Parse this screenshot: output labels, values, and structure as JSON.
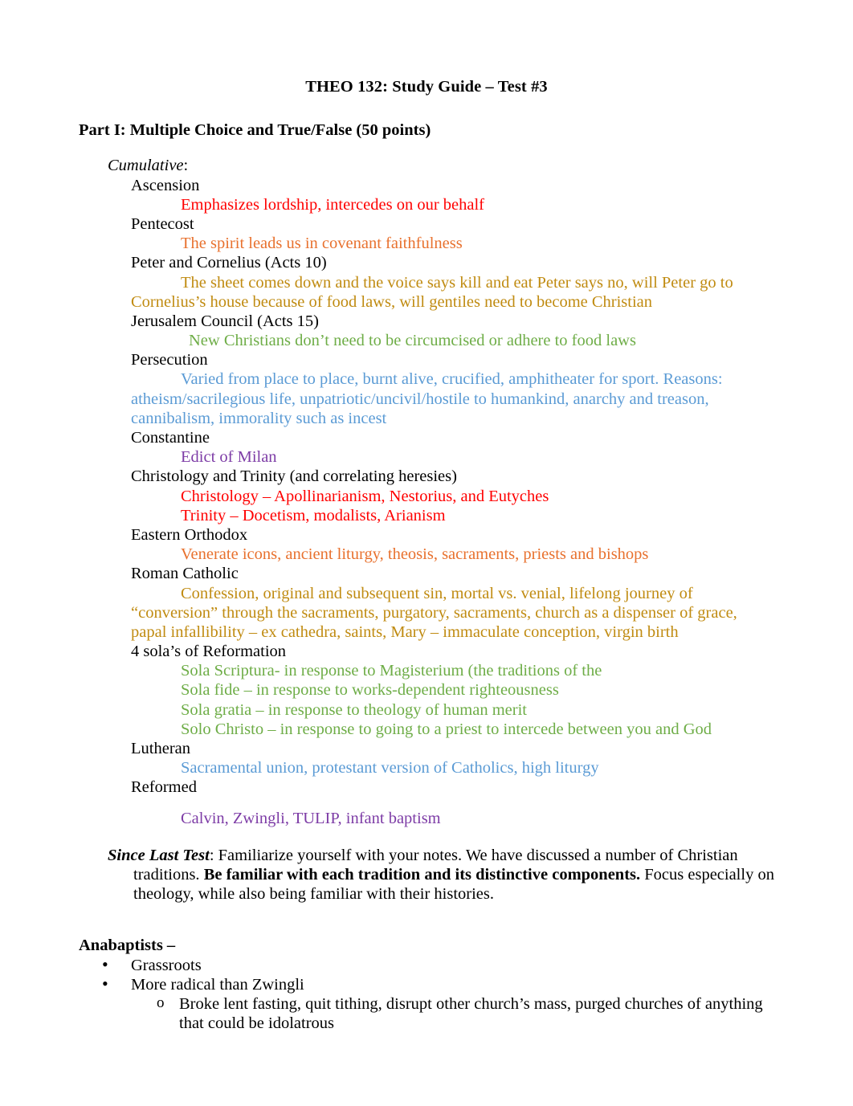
{
  "document": {
    "title": "THEO 132: Study Guide – Test #3",
    "part_i_heading": "Part I: Multiple Choice and True/False (50 points)",
    "cumulative_label": "Cumulative",
    "cumulative_colon": ":"
  },
  "colors": {
    "red": "#FF0000",
    "orange": "#E8712E",
    "gold": "#C08B11",
    "green": "#6EAD47",
    "blue": "#5B9BD5",
    "purple": "#7D3CA6",
    "black": "#000000"
  },
  "cumulative_items": [
    {
      "topic": "Ascension",
      "note": "Emphasizes lordship, intercedes on our behalf",
      "color": "red"
    },
    {
      "topic": "Pentecost",
      "note": "The spirit leads us in covenant faithfulness",
      "color": "orange"
    },
    {
      "topic": "Peter and Cornelius (Acts 10)",
      "note": "The sheet comes down and the voice says kill and eat Peter says no, will Peter go to Cornelius’s house because of food laws, will gentiles need to become Christian",
      "color": "gold"
    },
    {
      "topic": "Jerusalem Council (Acts 15)",
      "note": "New Christians don’t need to be circumcised or adhere to food laws",
      "color": "green"
    },
    {
      "topic": "Persecution",
      "note": "Varied from place to place, burnt alive, crucified, amphitheater for sport. Reasons: atheism/sacrilegious life, unpatriotic/uncivil/hostile to humankind, anarchy and treason, cannibalism, immorality such as incest",
      "color": "blue"
    },
    {
      "topic": "Constantine",
      "note": "Edict of Milan",
      "color": "purple"
    },
    {
      "topic": "Christology and Trinity (and correlating heresies)",
      "note": "Christology – Apollinarianism, Nestorius, and Eutyches",
      "note2": "Trinity – Docetism, modalists, Arianism",
      "color": "red"
    },
    {
      "topic": "Eastern Orthodox",
      "note": "Venerate icons, ancient liturgy, theosis, sacraments, priests and bishops",
      "color": "orange"
    },
    {
      "topic": "Roman Catholic",
      "note": "Confession, original and subsequent sin, mortal vs. venial, lifelong journey of “conversion” through the sacraments, purgatory, sacraments, church as a dispenser of grace, papal infallibility – ex cathedra, saints, Mary – immaculate conception, virgin birth",
      "color": "gold"
    },
    {
      "topic": "4 sola’s of Reformation",
      "note": "Sola Scriptura- in response to Magisterium (the traditions of the",
      "note2": "Sola fide – in response to works-dependent righteousness",
      "note3": "Sola gratia – in response to theology of human merit",
      "note4": "Solo Christo – in response to going to a priest to intercede between you and God",
      "color": "green"
    },
    {
      "topic": "Lutheran",
      "note": "Sacramental union, protestant version of Catholics, high liturgy",
      "color": "blue"
    },
    {
      "topic": "Reformed",
      "note": "Calvin, Zwingli, TULIP, infant baptism",
      "color": "purple"
    }
  ],
  "since_last_test": {
    "label": "Since Last Test",
    "colon": ": ",
    "text_1": "Familiarize yourself with your notes. We have discussed a number of Christian traditions. ",
    "bold_phrase": "Be familiar with each tradition and its distinctive components.",
    "text_2": " Focus especially on theology, while also being familiar with their histories."
  },
  "anabaptists": {
    "heading": "Anabaptists –",
    "bullet_glyph": "•",
    "subbullet_glyph": "o",
    "items": [
      {
        "text": "Grassroots",
        "sub": []
      },
      {
        "text": "More radical than Zwingli",
        "sub": [
          "Broke lent fasting, quit tithing, disrupt other church’s mass, purged churches of anything that could be idolatrous"
        ]
      }
    ]
  }
}
